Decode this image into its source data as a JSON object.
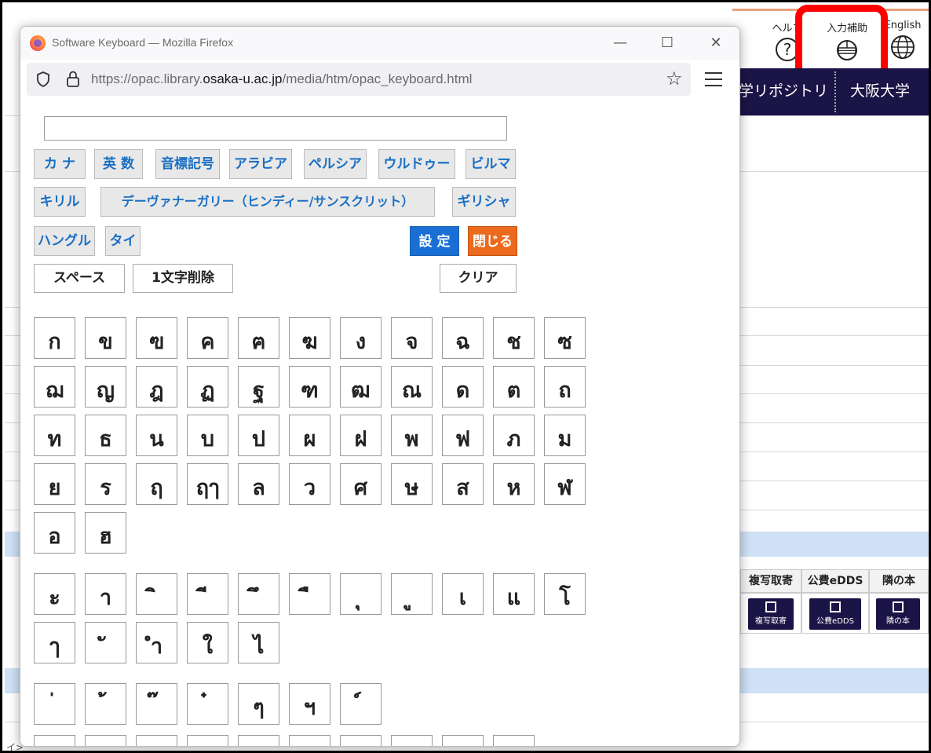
{
  "background": {
    "help_label": "ヘルプ",
    "help_icon": "?",
    "input_aid_label": "入力補助",
    "english_label": "English",
    "nav_item_1": "学リポジトリ",
    "nav_item_2": "大阪大学",
    "table_headers": [
      "複写取寄",
      "公費eDDS",
      "隣の本"
    ],
    "table_buttons": [
      "複写取寄",
      "公費eDDS",
      "隣の本"
    ],
    "bottom_text": "イ>",
    "highlight_color": "#ff0000",
    "nav_color": "#1b1446"
  },
  "window": {
    "title": "Software Keyboard — Mozilla Firefox",
    "url_prefix": "https://opac.library.",
    "url_domain": "osaka-u.ac.jp",
    "url_path": "/media/htm/opac_keyboard.html",
    "minimize_glyph": "—",
    "maximize_glyph": "☐",
    "close_glyph": "✕",
    "star_glyph": "☆"
  },
  "keyboard": {
    "input_value": "",
    "script_tabs_row1": [
      "カ ナ",
      "英 数",
      "音標記号",
      "アラビア",
      "ペルシア",
      "ウルドゥー",
      "ビルマ"
    ],
    "script_tabs_row2": [
      "キリル",
      "デーヴァナーガリー（ヒンディー/サンスクリット）",
      "ギリシャ"
    ],
    "script_tabs_row3": [
      "ハングル",
      "タイ"
    ],
    "settings_label": "設 定",
    "close_label": "閉じる",
    "space_label": "スペース",
    "delete_label": "1文字削除",
    "clear_label": "クリア",
    "consonants": [
      [
        "ก",
        "ข",
        "ฃ",
        "ค",
        "ฅ",
        "ฆ",
        "ง",
        "จ",
        "ฉ",
        "ช",
        "ซ"
      ],
      [
        "ฌ",
        "ญ",
        "ฎ",
        "ฏ",
        "ฐ",
        "ฑ",
        "ฒ",
        "ณ",
        "ด",
        "ต",
        "ถ"
      ],
      [
        "ท",
        "ธ",
        "น",
        "บ",
        "ป",
        "ผ",
        "ฝ",
        "พ",
        "ฟ",
        "ภ",
        "ม"
      ],
      [
        "ย",
        "ร",
        "ฤ",
        "ฤๅ",
        "ล",
        "ว",
        "ศ",
        "ษ",
        "ส",
        "ห",
        "ฬ"
      ],
      [
        "อ",
        "ฮ"
      ]
    ],
    "vowels": [
      [
        "ะ",
        "า",
        "ิ",
        "ี",
        "ึ",
        "ื",
        "ุ",
        "ู",
        "เ",
        "แ",
        "โ"
      ],
      [
        "ๅ",
        "ั",
        "ำ",
        "ใ",
        "ไ"
      ]
    ],
    "tones": [
      [
        "่",
        "้",
        "๊",
        "๋",
        "ๆ",
        "ฯ",
        "์"
      ]
    ]
  }
}
